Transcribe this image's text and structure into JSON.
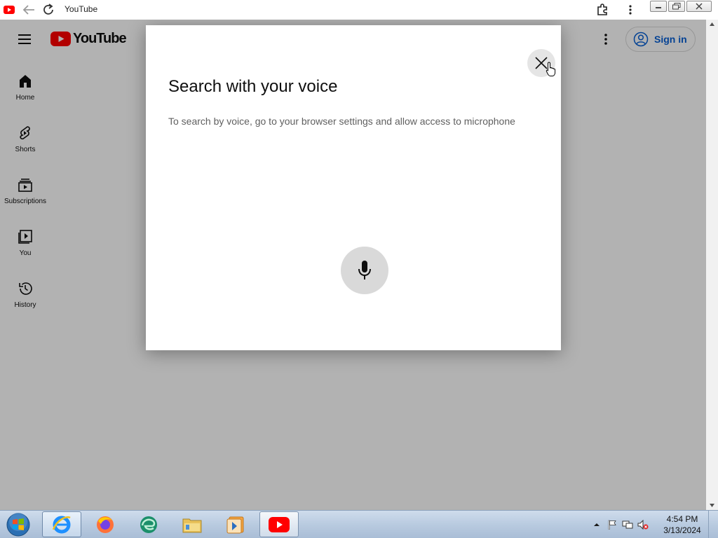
{
  "browser": {
    "tab_title": "YouTube"
  },
  "header": {
    "logo_text": "YouTube",
    "signin_label": "Sign in"
  },
  "sidebar": {
    "items": [
      {
        "label": "Home",
        "icon": "home-icon"
      },
      {
        "label": "Shorts",
        "icon": "shorts-icon"
      },
      {
        "label": "Subscriptions",
        "icon": "subscriptions-icon"
      },
      {
        "label": "You",
        "icon": "you-icon"
      },
      {
        "label": "History",
        "icon": "history-icon"
      }
    ]
  },
  "dialog": {
    "title": "Search with your voice",
    "message": "To search by voice, go to your browser settings and allow access to microphone"
  },
  "taskbar": {
    "apps": [
      "internet-explorer",
      "firefox",
      "edge",
      "file-explorer",
      "media-player",
      "youtube"
    ],
    "clock_time": "4:54 PM",
    "clock_date": "3/13/2024"
  },
  "colors": {
    "youtube_red": "#ff0000",
    "link_blue": "#065fd4",
    "overlay": "rgba(0,0,0,0.30)"
  }
}
